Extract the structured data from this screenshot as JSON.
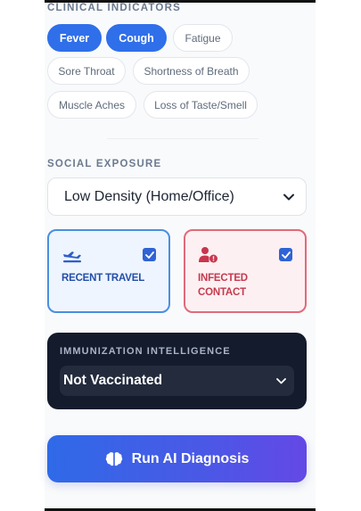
{
  "clinical": {
    "title": "CLINICAL INDICATORS",
    "symptoms": [
      {
        "label": "Fever",
        "selected": true
      },
      {
        "label": "Cough",
        "selected": true
      },
      {
        "label": "Fatigue",
        "selected": false
      },
      {
        "label": "Sore Throat",
        "selected": false
      },
      {
        "label": "Shortness of Breath",
        "selected": false
      },
      {
        "label": "Muscle Aches",
        "selected": false
      },
      {
        "label": "Loss of Taste/Smell",
        "selected": false
      }
    ]
  },
  "social": {
    "title": "SOCIAL EXPOSURE",
    "density_selected": "Low Density (Home/Office)",
    "recent_travel": {
      "label": "RECENT TRAVEL",
      "checked": true
    },
    "infected_contact": {
      "label": "INFECTED CONTACT",
      "checked": true
    }
  },
  "immunization": {
    "title": "IMMUNIZATION INTELLIGENCE",
    "selected": "Not Vaccinated"
  },
  "run_button": {
    "label": "Run AI Diagnosis"
  },
  "colors": {
    "accent_blue": "#2f6fea",
    "travel_border": "#4a8fe0",
    "contact_border": "#e06a7a",
    "dark_panel": "#141b2d"
  },
  "icons": {
    "travel": "airplane-icon",
    "contact": "user-alert-icon",
    "run": "brain-icon",
    "dropdown": "chevron-down-icon",
    "checkbox": "check-icon"
  }
}
